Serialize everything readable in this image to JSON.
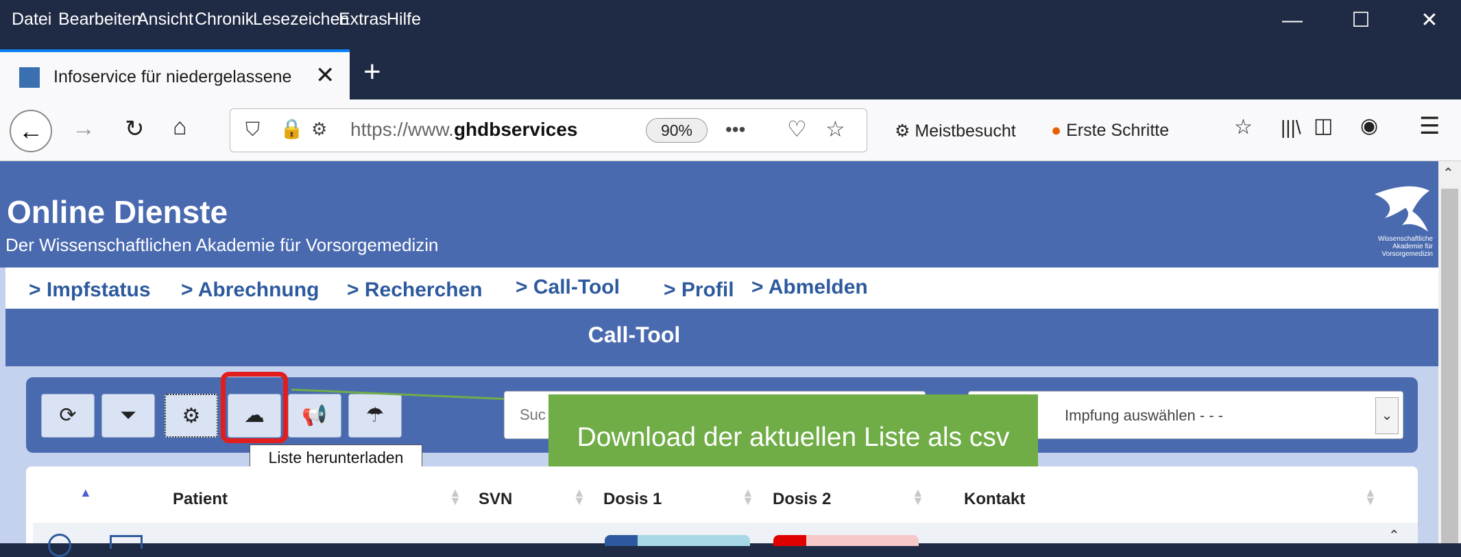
{
  "menubar": {
    "items": [
      {
        "label": "Datei"
      },
      {
        "label": "Bearbeiten"
      },
      {
        "label": "Ansicht"
      },
      {
        "label": "Chronik"
      },
      {
        "label": "Lesezeichen"
      },
      {
        "label": "Extras"
      },
      {
        "label": "Hilfe"
      }
    ]
  },
  "window": {
    "minimize": "—",
    "maximize": "☐",
    "close": "✕"
  },
  "tab": {
    "title": "Infoservice für niedergelassene",
    "close": "✕",
    "new_tab": "+"
  },
  "navbar": {
    "url_prefix": "https://www.",
    "url_domain": "ghdbservices",
    "zoom": "90%",
    "more": "•••",
    "bookmarks": [
      {
        "label": "Meistbesucht"
      },
      {
        "label": "Erste Schritte"
      }
    ]
  },
  "site": {
    "title": "Online Dienste",
    "subtitle": "Der Wissenschaftlichen Akademie für Vorsorgemedizin",
    "logo_text": "Wissenschaftliche Akademie für Vorsorgemedizin",
    "nav": [
      {
        "label": "> Impfstatus"
      },
      {
        "label": "> Abrechnung"
      },
      {
        "label": "> Recherchen"
      },
      {
        "label": "> Call-Tool"
      },
      {
        "label": "> Profil"
      },
      {
        "label": "> Abmelden"
      }
    ],
    "section_title": "Call-Tool"
  },
  "toolbar": {
    "search_placeholder": "Suc",
    "vaccine_select": "Impfung auswählen - - -",
    "tooltip": "Liste herunterladen"
  },
  "callout": {
    "text": "Download der aktuellen Liste als csv"
  },
  "table": {
    "columns": [
      "Patient",
      "SVN",
      "Dosis 1",
      "Dosis 2",
      "Kontakt"
    ]
  },
  "colors": {
    "header_blue": "#4a6ab0",
    "callout_green": "#70ad47",
    "highlight_red": "#e21d1d"
  }
}
